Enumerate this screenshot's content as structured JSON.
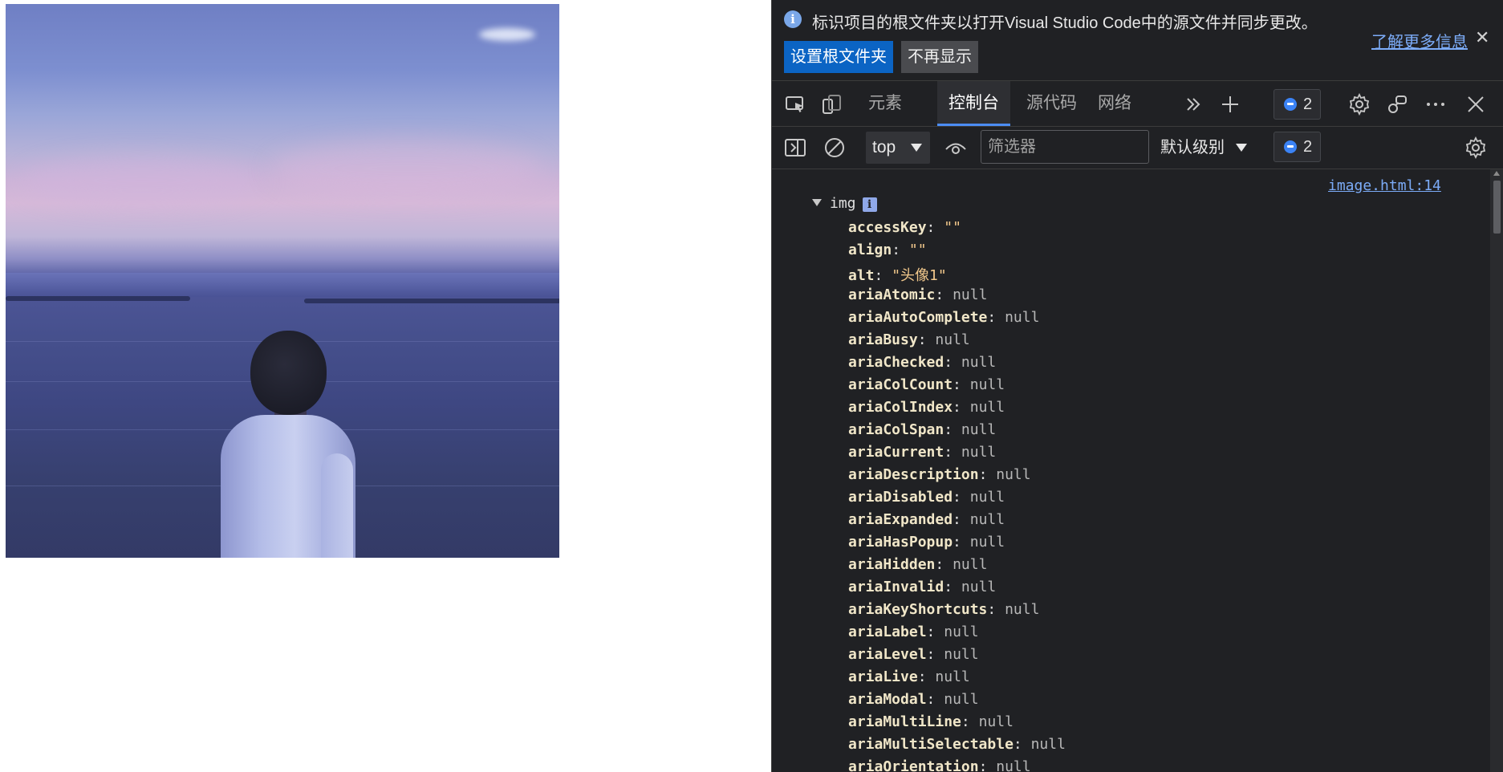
{
  "infobar": {
    "message": "标识项目的根文件夹以打开Visual Studio Code中的源文件并同步更改。",
    "learn_more": "了解更多信息",
    "set_root_button": "设置根文件夹",
    "dont_show_button": "不再显示",
    "info_glyph": "i",
    "close_glyph": "✕"
  },
  "tabs": [
    {
      "label": "元素",
      "active": false
    },
    {
      "label": "控制台",
      "active": true
    },
    {
      "label": "源代码",
      "active": false
    },
    {
      "label": "网络",
      "active": false
    }
  ],
  "issues_count": "2",
  "console_toolbar": {
    "context": "top",
    "filter_placeholder": "筛选器",
    "level": "默认级别",
    "issues_count": "2"
  },
  "console": {
    "source_link": "image.html:14",
    "object_label": "img",
    "info_glyph": "i",
    "properties": [
      {
        "key": "accessKey",
        "value": "\"\"",
        "type": "str"
      },
      {
        "key": "align",
        "value": "\"\"",
        "type": "str"
      },
      {
        "key": "alt",
        "value": "\"头像1\"",
        "type": "str"
      },
      {
        "key": "ariaAtomic",
        "value": "null",
        "type": "null"
      },
      {
        "key": "ariaAutoComplete",
        "value": "null",
        "type": "null"
      },
      {
        "key": "ariaBusy",
        "value": "null",
        "type": "null"
      },
      {
        "key": "ariaChecked",
        "value": "null",
        "type": "null"
      },
      {
        "key": "ariaColCount",
        "value": "null",
        "type": "null"
      },
      {
        "key": "ariaColIndex",
        "value": "null",
        "type": "null"
      },
      {
        "key": "ariaColSpan",
        "value": "null",
        "type": "null"
      },
      {
        "key": "ariaCurrent",
        "value": "null",
        "type": "null"
      },
      {
        "key": "ariaDescription",
        "value": "null",
        "type": "null"
      },
      {
        "key": "ariaDisabled",
        "value": "null",
        "type": "null"
      },
      {
        "key": "ariaExpanded",
        "value": "null",
        "type": "null"
      },
      {
        "key": "ariaHasPopup",
        "value": "null",
        "type": "null"
      },
      {
        "key": "ariaHidden",
        "value": "null",
        "type": "null"
      },
      {
        "key": "ariaInvalid",
        "value": "null",
        "type": "null"
      },
      {
        "key": "ariaKeyShortcuts",
        "value": "null",
        "type": "null"
      },
      {
        "key": "ariaLabel",
        "value": "null",
        "type": "null"
      },
      {
        "key": "ariaLevel",
        "value": "null",
        "type": "null"
      },
      {
        "key": "ariaLive",
        "value": "null",
        "type": "null"
      },
      {
        "key": "ariaModal",
        "value": "null",
        "type": "null"
      },
      {
        "key": "ariaMultiLine",
        "value": "null",
        "type": "null"
      },
      {
        "key": "ariaMultiSelectable",
        "value": "null",
        "type": "null"
      },
      {
        "key": "ariaOrientation",
        "value": "null",
        "type": "null"
      }
    ]
  },
  "icons": {
    "inspect": "inspect-element-icon",
    "device": "device-emulation-icon",
    "more_tabs": "more-tabs-icon",
    "new_tab": "add-tab-icon",
    "settings": "settings-gear-icon",
    "connect": "connect-icon",
    "menu": "more-menu-icon",
    "close": "close-icon",
    "sidebar": "sidebar-toggle-icon",
    "clear": "clear-console-icon",
    "eye": "live-expression-icon",
    "console_settings": "console-settings-icon"
  },
  "colors": {
    "accent": "#4c8df6",
    "primary_button": "#0b64c4",
    "link": "#7cacf8",
    "panel_bg": "#202124"
  }
}
